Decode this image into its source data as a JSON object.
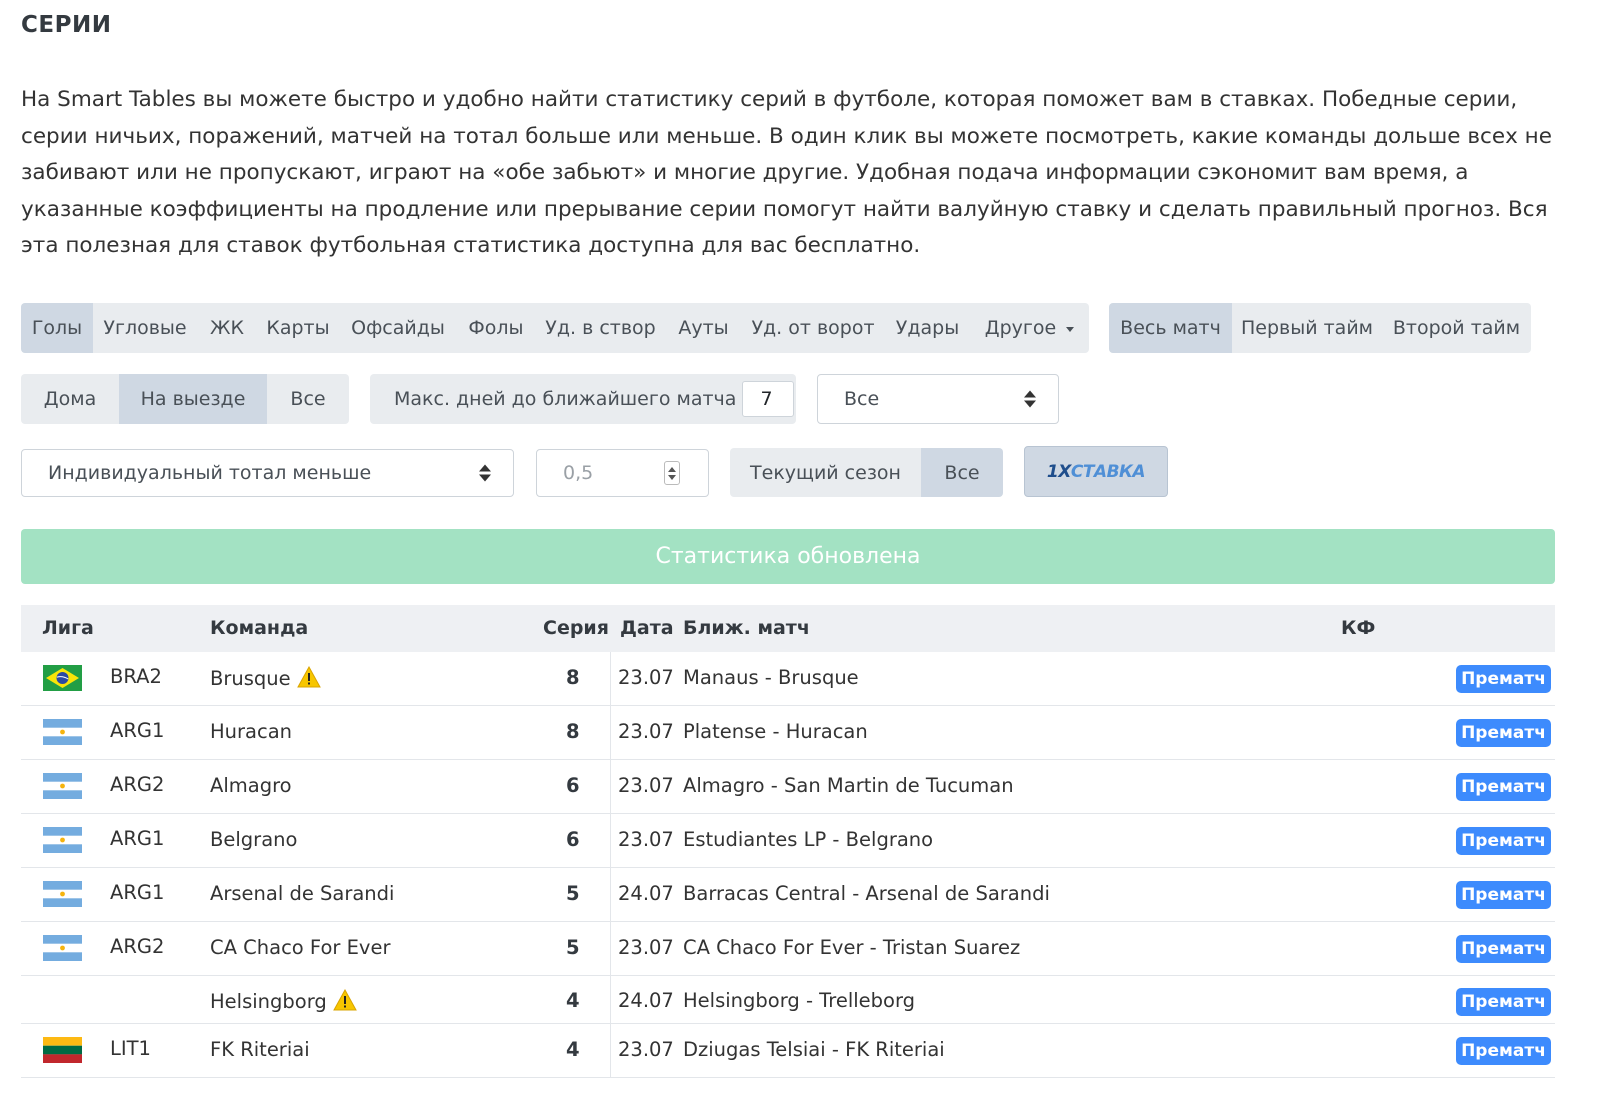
{
  "header": {
    "title": "СЕРИИ",
    "intro": "На Smart Tables вы можете быстро и удобно найти статистику серий в футболе, которая поможет вам в ставках. Победные серии, серии ничьих, поражений, матчей на тотал больше или меньше. В один клик вы можете посмотреть, какие команды дольше всех не забивают или не пропускают, играют на «обе забьют» и многие другие. Удобная подача информации сэкономит вам время, а указанные коэффициенты на продление или прерывание серии помогут найти валуйную ставку и сделать правильный прогноз. Вся эта полезная для ставок футбольная статистика доступна для вас бесплатно."
  },
  "stat_tabs": [
    "Голы",
    "Угловые",
    "ЖК",
    "Карты",
    "Офсайды",
    "Фолы",
    "Уд. в створ",
    "Ауты",
    "Уд. от ворот",
    "Удары",
    "Другое"
  ],
  "stat_tabs_active": "Голы",
  "period_tabs": [
    "Весь матч",
    "Первый тайм",
    "Второй тайм"
  ],
  "period_active": "Весь матч",
  "venue_tabs": [
    "Дома",
    "На выезде",
    "Все"
  ],
  "venue_active": "На выезде",
  "days_filter": {
    "label": "Макс. дней до ближайшего матча",
    "value": "7"
  },
  "league_select": {
    "value": "Все"
  },
  "series_select": {
    "value": "Индивидуальный тотал меньше"
  },
  "threshold_input": {
    "value": "0,5"
  },
  "season_tabs": [
    "Текущий сезон",
    "Все"
  ],
  "season_active": "Все",
  "bookmaker": {
    "part1": "1X",
    "part2": "СТАВКА"
  },
  "alert": {
    "text": "Статистика обновлена"
  },
  "table": {
    "headers": {
      "league": "Лига",
      "team": "Команда",
      "series": "Серия",
      "date": "Дата",
      "next_match": "Ближ. матч",
      "kf": "КФ"
    },
    "rows": [
      {
        "flag": "brazil",
        "league": "BRA2",
        "team": "Brusque",
        "warning": true,
        "series": "8",
        "date": "23.07",
        "match": "Manaus - Brusque",
        "action": "Прематч"
      },
      {
        "flag": "argentina",
        "league": "ARG1",
        "team": "Huracan",
        "warning": false,
        "series": "8",
        "date": "23.07",
        "match": "Platense - Huracan",
        "action": "Прематч"
      },
      {
        "flag": "argentina",
        "league": "ARG2",
        "team": "Almagro",
        "warning": false,
        "series": "6",
        "date": "23.07",
        "match": "Almagro - San Martin de Tucuman",
        "action": "Прематч"
      },
      {
        "flag": "argentina",
        "league": "ARG1",
        "team": "Belgrano",
        "warning": false,
        "series": "6",
        "date": "23.07",
        "match": "Estudiantes LP - Belgrano",
        "action": "Прематч"
      },
      {
        "flag": "argentina",
        "league": "ARG1",
        "team": "Arsenal de Sarandi",
        "warning": false,
        "series": "5",
        "date": "24.07",
        "match": "Barracas Central - Arsenal de Sarandi",
        "action": "Прематч"
      },
      {
        "flag": "argentina",
        "league": "ARG2",
        "team": "CA Chaco For Ever",
        "warning": false,
        "series": "5",
        "date": "23.07",
        "match": "CA Chaco For Ever - Tristan Suarez",
        "action": "Прематч"
      },
      {
        "flag": "none",
        "league": "",
        "team": "Helsingborg",
        "warning": true,
        "series": "4",
        "date": "24.07",
        "match": "Helsingborg - Trelleborg",
        "action": "Прематч"
      },
      {
        "flag": "lithuania",
        "league": "LIT1",
        "team": "FK Riteriai",
        "warning": false,
        "series": "4",
        "date": "23.07",
        "match": "Dziugas Telsiai - FK Riteriai",
        "action": "Прематч"
      }
    ]
  }
}
